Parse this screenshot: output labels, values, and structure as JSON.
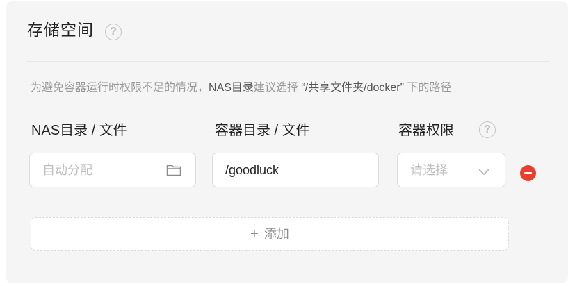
{
  "section": {
    "title": "存储空间",
    "help_icon": "question-circle-icon"
  },
  "hint": {
    "prefix": "为避免容器运行时权限不足的情况，",
    "highlight": "NAS目录",
    "middle": "建议选择 ",
    "path": "“/共享文件夹/docker”",
    "suffix": " 下的路径"
  },
  "columns": {
    "nas": "NAS目录 / 文件",
    "container": "容器目录 / 文件",
    "permission": "容器权限"
  },
  "row": {
    "nas_placeholder": "自动分配",
    "nas_icon": "folder-icon",
    "container_value": "/goodluck",
    "permission_placeholder": "请选择",
    "permission_icon": "chevron-down-icon",
    "remove_icon": "minus-circle-icon"
  },
  "add": {
    "icon": "+",
    "label": "添加"
  },
  "colors": {
    "remove": "#e8402f",
    "panel": "#f5f5f5"
  }
}
